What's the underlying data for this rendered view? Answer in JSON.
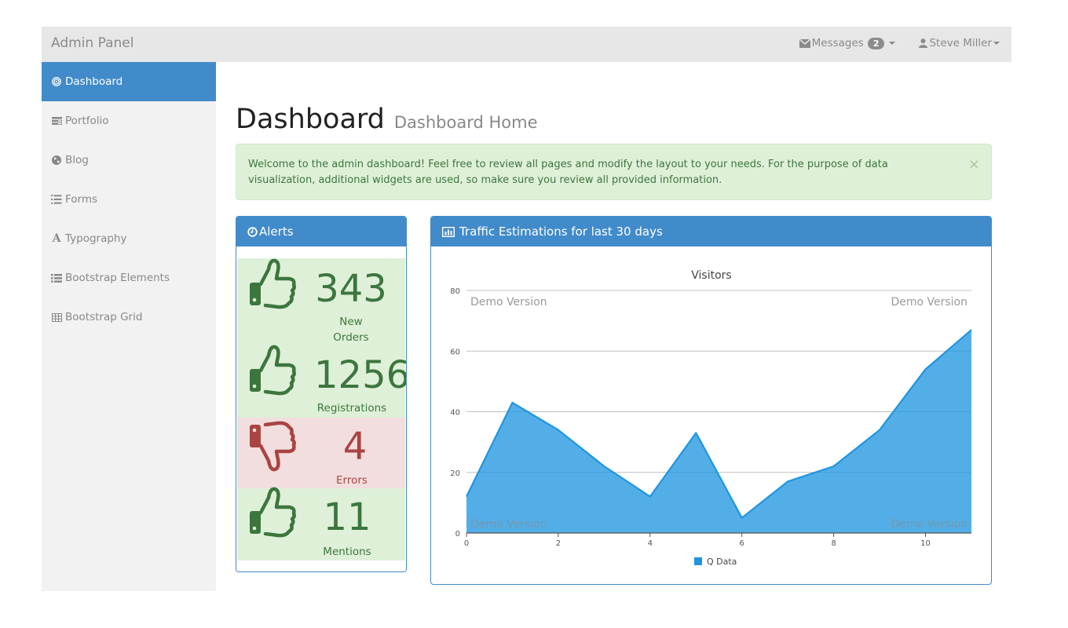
{
  "navbar": {
    "brand": "Admin Panel",
    "messages_label": "Messages",
    "messages_count": "2",
    "user_name": "Steve Miller"
  },
  "sidebar": {
    "items": [
      {
        "label": "Dashboard",
        "icon": "dashboard-icon",
        "active": true
      },
      {
        "label": "Portfolio",
        "icon": "portfolio-icon"
      },
      {
        "label": "Blog",
        "icon": "globe-icon"
      },
      {
        "label": "Forms",
        "icon": "ordered-list-icon"
      },
      {
        "label": "Typography",
        "icon": "font-icon"
      },
      {
        "label": "Bootstrap Elements",
        "icon": "list-icon"
      },
      {
        "label": "Bootstrap Grid",
        "icon": "table-icon"
      }
    ]
  },
  "page": {
    "title": "Dashboard",
    "subtitle": "Dashboard Home"
  },
  "alert": {
    "text": "Welcome to the admin dashboard! Feel free to review all pages and modify the layout to your needs. For the purpose of data visualization, additional widgets are used, so make sure you review all provided information.",
    "close": "×"
  },
  "alerts_panel": {
    "title": "Alerts",
    "stats": [
      {
        "value": "343",
        "label": "New Orders",
        "status": "success",
        "icon": "thumbs-up-icon"
      },
      {
        "value": "1256",
        "label": "Registrations",
        "status": "success",
        "icon": "thumbs-up-icon"
      },
      {
        "value": "4",
        "label": "Errors",
        "status": "danger",
        "icon": "thumbs-down-icon"
      },
      {
        "value": "11",
        "label": "Mentions",
        "status": "success",
        "icon": "thumbs-up-icon"
      }
    ]
  },
  "traffic_panel": {
    "title": "Traffic Estimations for last 30 days",
    "watermark": "Demo Version"
  },
  "colors": {
    "primary": "#428bca",
    "success_bg": "#dff0d8",
    "success_text": "#3c763d",
    "danger_bg": "#f2dede",
    "danger_text": "#a94442",
    "series": "#1f95e0"
  },
  "chart_data": {
    "type": "area",
    "title": "Visitors",
    "x": [
      0,
      1,
      2,
      3,
      4,
      5,
      6,
      7,
      8,
      9,
      10,
      11
    ],
    "series": [
      {
        "name": "Q Data",
        "values": [
          12,
          43,
          34,
          22,
          12,
          33,
          5,
          17,
          22,
          34,
          54,
          67
        ]
      }
    ],
    "xlim": [
      0,
      11
    ],
    "ylim": [
      0,
      80
    ],
    "x_ticks": [
      0,
      2,
      4,
      6,
      8,
      10
    ],
    "y_ticks": [
      0,
      20,
      40,
      60,
      80
    ],
    "xlabel": "",
    "ylabel": "",
    "grid": true,
    "legend": "bottom-center"
  }
}
